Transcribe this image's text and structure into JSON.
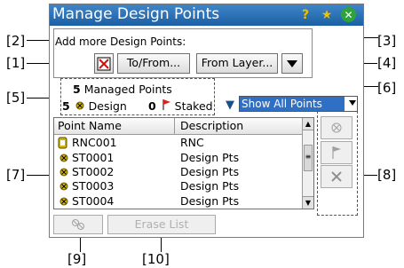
{
  "window": {
    "title": "Manage Design Points"
  },
  "titlebar": {
    "help_icon": "help-icon",
    "favorite_icon": "star-icon",
    "close_icon": "close-icon"
  },
  "add_group": {
    "label": "Add more Design Points:",
    "to_from_label": "To/From...",
    "from_layer_label": "From Layer..."
  },
  "summary": {
    "managed_count": "5",
    "managed_label": "Managed Points",
    "design_count": "5",
    "design_label": "Design",
    "staked_count": "0",
    "staked_label": "Staked"
  },
  "filter": {
    "selected": "Show All Points"
  },
  "table": {
    "headers": [
      "Point Name",
      "Description"
    ],
    "rows": [
      {
        "name": "RNC001",
        "description": "RNC"
      },
      {
        "name": "ST0001",
        "description": "Design Pts"
      },
      {
        "name": "ST0002",
        "description": "Design Pts"
      },
      {
        "name": "ST0003",
        "description": "Design Pts"
      },
      {
        "name": "ST0004",
        "description": "Design Pts"
      }
    ]
  },
  "bottom": {
    "erase_label": "Erase List"
  },
  "callouts": [
    "[1]",
    "[2]",
    "[3]",
    "[4]",
    "[5]",
    "[6]",
    "[7]",
    "[8]",
    "[9]",
    "[10]"
  ],
  "colors": {
    "title_bar": "#1c5fa4",
    "selection": "#2f6fc4",
    "staked_flag": "#e0201e",
    "design_marker": "#d4b400"
  }
}
